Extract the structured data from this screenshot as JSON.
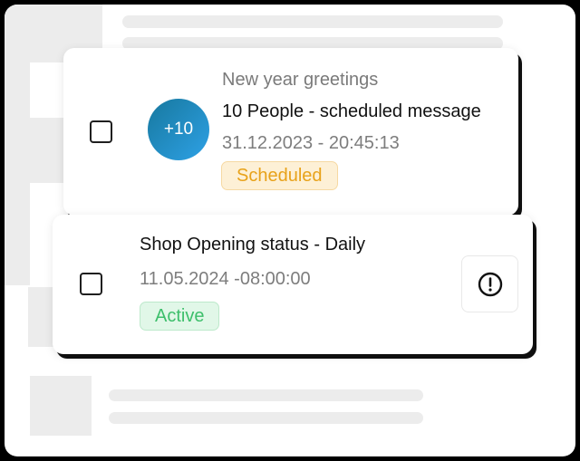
{
  "cards": [
    {
      "subject": "New year greetings",
      "title": "10 People - scheduled message",
      "date": "31.12.2023 - 20:45:13",
      "status": "Scheduled",
      "avatar": "+10"
    },
    {
      "title": "Shop Opening status - Daily",
      "date": "11.05.2024 -08:00:00",
      "status": "Active",
      "action_icon": "alert-circle-icon"
    }
  ],
  "colors": {
    "scheduled": "#e8a21a",
    "active": "#3dbf6b",
    "avatar_gradient_start": "#17789e",
    "avatar_gradient_end": "#2ea1e6"
  }
}
